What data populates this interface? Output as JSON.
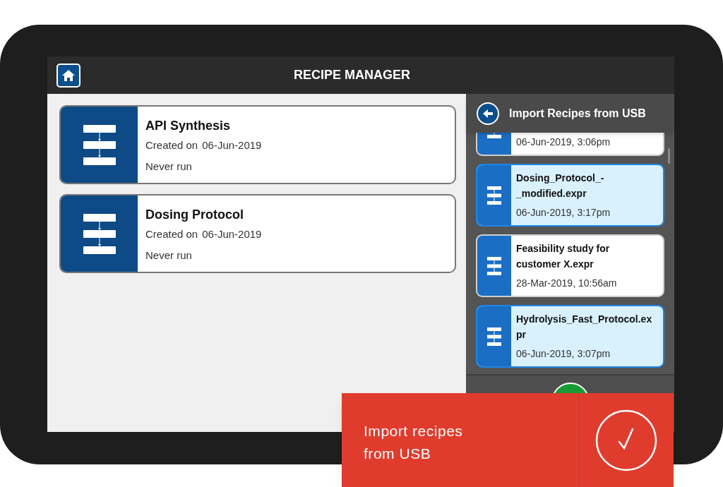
{
  "header": {
    "title": "RECIPE MANAGER"
  },
  "recipes": [
    {
      "name": "API Synthesis",
      "created_label": "Created on",
      "created_date": "06-Jun-2019",
      "last_run": "Never run"
    },
    {
      "name": "Dosing Protocol",
      "created_label": "Created on",
      "created_date": "06-Jun-2019",
      "last_run": "Never run"
    }
  ],
  "import_panel": {
    "title": "Import Recipes from USB",
    "files": [
      {
        "date": "06-Jun-2019, 3:06pm",
        "selected": false
      },
      {
        "name": "Dosing_Protocol_-_modified.expr",
        "date": "06-Jun-2019, 3:17pm",
        "selected": true
      },
      {
        "name": "Feasibility study for customer X.expr",
        "date": "28-Mar-2019, 10:56am",
        "selected": false
      },
      {
        "name": "Hydrolysis_Fast_Protocol.expr",
        "date": "06-Jun-2019, 3:07pm",
        "selected": true
      }
    ]
  },
  "callout": {
    "text": "Import recipes from USB"
  }
}
